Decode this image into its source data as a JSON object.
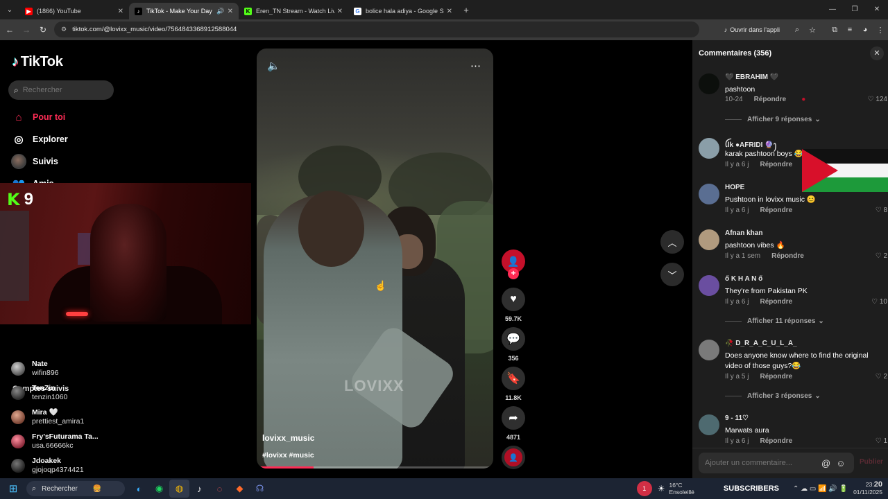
{
  "browser": {
    "tabs": [
      {
        "title": "(1866) YouTube",
        "color": "#ff0000",
        "glyph": "▶",
        "active": false
      },
      {
        "title": "TikTok - Make Your Day",
        "color": "#000000",
        "glyph": "♪",
        "active": true
      },
      {
        "title": "Eren_TN Stream - Watch Live on",
        "color": "#53fc18",
        "glyph": "K",
        "active": false
      },
      {
        "title": "bolice hala adiya - Google Sear",
        "color": "#ffffff",
        "glyph": "G",
        "active": false
      }
    ],
    "url": "tiktok.com/@lovixx_music/video/7564843368912588044",
    "open_in_app": "Ouvrir dans l'appli"
  },
  "nav": {
    "logo": "TikTok",
    "search_placeholder": "Rechercher",
    "items": [
      {
        "label": "Pour toi",
        "icon": "home-icon"
      },
      {
        "label": "Explorer",
        "icon": "compass-icon"
      },
      {
        "label": "Suivis",
        "icon": "following-avatar"
      },
      {
        "label": "Amis",
        "icon": "friends-icon"
      }
    ],
    "following_title": "Comptes suivis",
    "following": [
      {
        "name": "Nate",
        "handle": "wifin896"
      },
      {
        "name": "TenZin",
        "handle": "tenzin1060"
      },
      {
        "name": "Mira 🤍",
        "handle": "prettiest_amira1"
      },
      {
        "name": "Fry'sFuturama Ta...",
        "handle": "usa.66666kc"
      },
      {
        "name": "Jdoakek",
        "handle": "gjojoqp4374421"
      }
    ]
  },
  "webcam": {
    "badge_letter": "K",
    "badge_number": "9"
  },
  "video": {
    "watermark": "LOVIXX",
    "author": "lovixx_music",
    "tags": "#lovixx #music",
    "progress_fraction": 0.24,
    "likes": "59.7K",
    "comments": "356",
    "saves": "11.8K",
    "shares": "4871"
  },
  "comments_panel": {
    "title": "Commentaires (356)",
    "reply_label": "Répondre",
    "input_placeholder": "Ajouter un commentaire...",
    "publish_label": "Publier",
    "items": [
      {
        "user": "🖤 EBRAHIM 🖤",
        "text": "pashtoon",
        "time": "10-24",
        "likes": "124",
        "avatar": "#0c0f0c"
      },
      {
        "user": "ꪶlk ●AFRIDI 🔮ꫂ",
        "text": "karak pashtoon boys 😂",
        "time": "Il y a 6 j",
        "likes": "",
        "avatar": "#8a9ea8"
      },
      {
        "user": "HOPE",
        "text": "Pushtoon in lovixx music 😊",
        "time": "Il y a 6 j",
        "likes": "8",
        "avatar": "#5a6e92"
      },
      {
        "user": "Afnan khan",
        "text": "pashtoon vibes 🔥",
        "time": "Il y a 1 sem",
        "likes": "2",
        "avatar": "#b09a7e"
      },
      {
        "user": "ő K H A N ő",
        "text": "They're from Pakistan PK",
        "time": "Il y a 6 j",
        "likes": "10",
        "avatar": "#6a4ea0"
      },
      {
        "user": "🥀 D_R_A_C_U_L_A_",
        "text": "Does anyone know where to find the original video of those guys?😂",
        "time": "Il y a 5 j",
        "likes": "2",
        "avatar": "#7a7a7a"
      },
      {
        "user": "9 - 11♡",
        "text": "Marwats aura",
        "time": "Il y a 6 j",
        "likes": "1",
        "avatar": "#4e6a70"
      }
    ],
    "more_replies": [
      "Afficher 9 réponses",
      "Afficher 11 réponses",
      "Afficher 3 réponses"
    ]
  },
  "taskbar": {
    "search": "Rechercher",
    "notif_count": "1",
    "weather": "16°C",
    "weather_sub": "Ensoleillé",
    "subscribers": "SUBSCRIBERS",
    "time": "20",
    "time_prefix": "23:",
    "date": "01/11/2025"
  },
  "colors": {
    "accent": "#fe2c55",
    "panel": "#1e1e1e"
  }
}
